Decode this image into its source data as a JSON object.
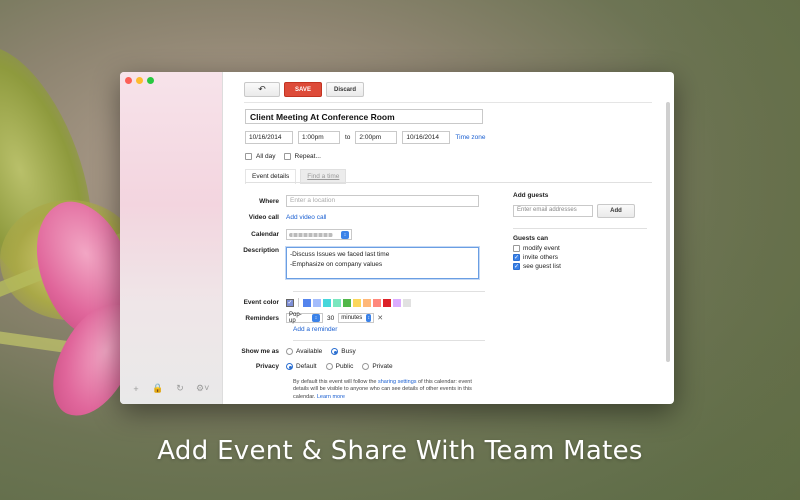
{
  "toolbar": {
    "back_icon": "back-arrow-icon",
    "save_label": "SAVE",
    "discard_label": "Discard"
  },
  "event": {
    "title": "Client Meeting At Conference Room",
    "start_date": "10/16/2014",
    "start_time": "1:00pm",
    "to_label": "to",
    "end_time": "2:00pm",
    "end_date": "10/16/2014",
    "timezone_link": "Time zone",
    "all_day_label": "All day",
    "repeat_label": "Repeat..."
  },
  "tabs": {
    "event_details": "Event details",
    "find_time": "Find a time"
  },
  "details": {
    "where_label": "Where",
    "where_placeholder": "Enter a location",
    "video_label": "Video call",
    "video_link": "Add video call",
    "calendar_label": "Calendar",
    "description_label": "Description",
    "description_line1": "-Discuss Issues we faced last time",
    "description_line2": "-Emphasize on company values",
    "event_color_label": "Event color",
    "colors": [
      "#7d8ed6",
      "#5484ed",
      "#a4bdfc",
      "#46d6db",
      "#7ae7bf",
      "#51b749",
      "#fbd75b",
      "#ffb878",
      "#ff887c",
      "#dc2127",
      "#dbadff",
      "#e1e1e1"
    ],
    "reminders_label": "Reminders",
    "reminder_type": "Pop-up",
    "reminder_amount": "30",
    "reminder_unit": "minutes",
    "add_reminder_link": "Add a reminder",
    "show_me_as_label": "Show me as",
    "available_label": "Available",
    "busy_label": "Busy",
    "privacy_label": "Privacy",
    "default_label": "Default",
    "public_label": "Public",
    "private_label": "Private",
    "privacy_note_1": "By default this event will follow the ",
    "privacy_note_link": "sharing settings",
    "privacy_note_2": " of this calendar: event details will be visible to anyone who can see details of other events in this calendar. ",
    "learn_more": "Learn more"
  },
  "guests": {
    "heading": "Add guests",
    "placeholder": "Enter email addresses",
    "add_button": "Add",
    "guests_can_heading": "Guests can",
    "options": [
      {
        "label": "modify event",
        "checked": false
      },
      {
        "label": "invite others",
        "checked": true
      },
      {
        "label": "see guest list",
        "checked": true
      }
    ]
  },
  "caption": "Add Event & Share With Team Mates"
}
